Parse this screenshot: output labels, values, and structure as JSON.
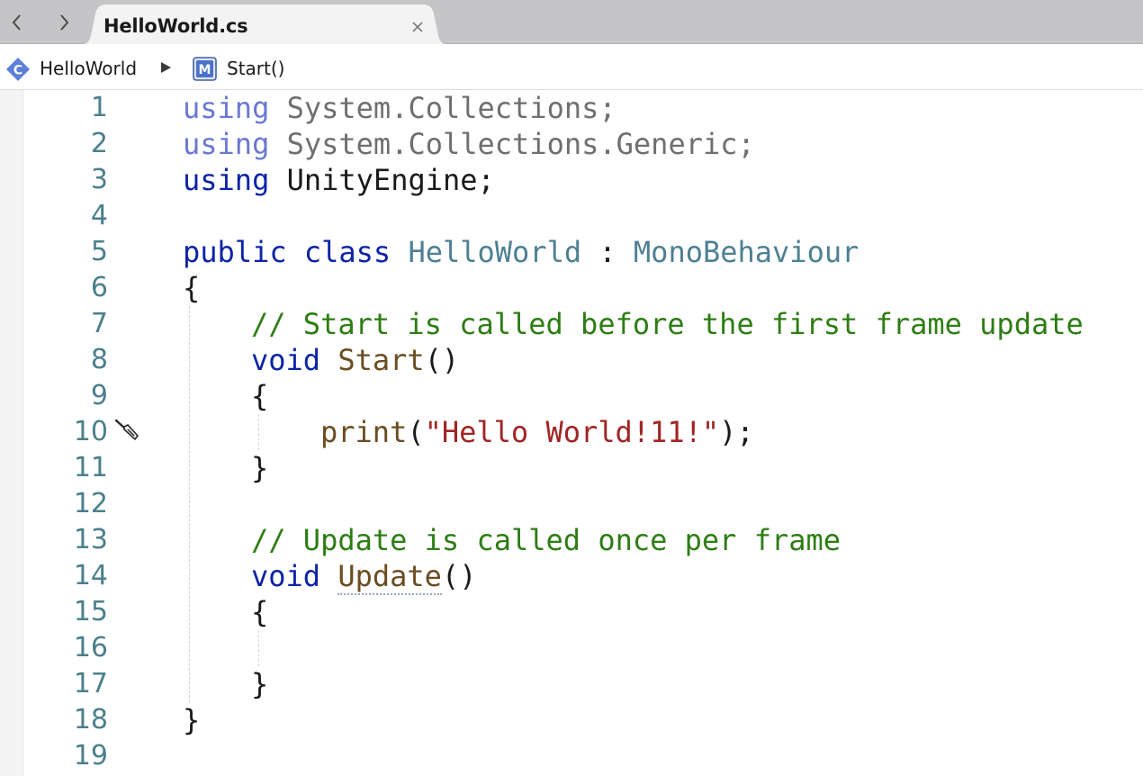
{
  "tabs": [
    {
      "title": "HelloWorld.cs",
      "active": true
    }
  ],
  "breadcrumb": {
    "class_icon_letter": "C",
    "class_name": "HelloWorld",
    "method_icon_letter": "M",
    "method_name": "Start()"
  },
  "colors": {
    "keyword": "#0c23a6",
    "keyword_dim": "#6a78d0",
    "type": "#4d8092",
    "comment": "#2e7d14",
    "method": "#6b4d22",
    "string": "#a12424",
    "line_number": "#4b7f8c"
  },
  "editor": {
    "line_numbers": [
      "1",
      "2",
      "3",
      "4",
      "5",
      "6",
      "7",
      "8",
      "9",
      "10",
      "11",
      "12",
      "13",
      "14",
      "15",
      "16",
      "17",
      "18",
      "19"
    ],
    "lines": {
      "l1": {
        "kw": "using",
        "rest": " System.Collections;"
      },
      "l2": {
        "kw": "using",
        "rest": " System.Collections.Generic;"
      },
      "l3": {
        "kw": "using",
        "rest": " UnityEngine;"
      },
      "l5": {
        "kw1": "public",
        "kw2": "class",
        "name": "HelloWorld",
        "sep": " : ",
        "base": "MonoBehaviour"
      },
      "l6": {
        "text": "{"
      },
      "l7": {
        "comment": "// Start is called before the first frame update"
      },
      "l8": {
        "kw": "void",
        "name": "Start",
        "parens": "()"
      },
      "l9": {
        "text": "{"
      },
      "l10": {
        "fn": "print",
        "open": "(",
        "string": "\"Hello World!11!\"",
        "close": ");"
      },
      "l11": {
        "text": "}"
      },
      "l13": {
        "comment": "// Update is called once per frame"
      },
      "l14": {
        "kw": "void",
        "name": "Update",
        "parens": "()"
      },
      "l15": {
        "text": "{"
      },
      "l17": {
        "text": "}"
      },
      "l18": {
        "text": "}"
      }
    }
  }
}
